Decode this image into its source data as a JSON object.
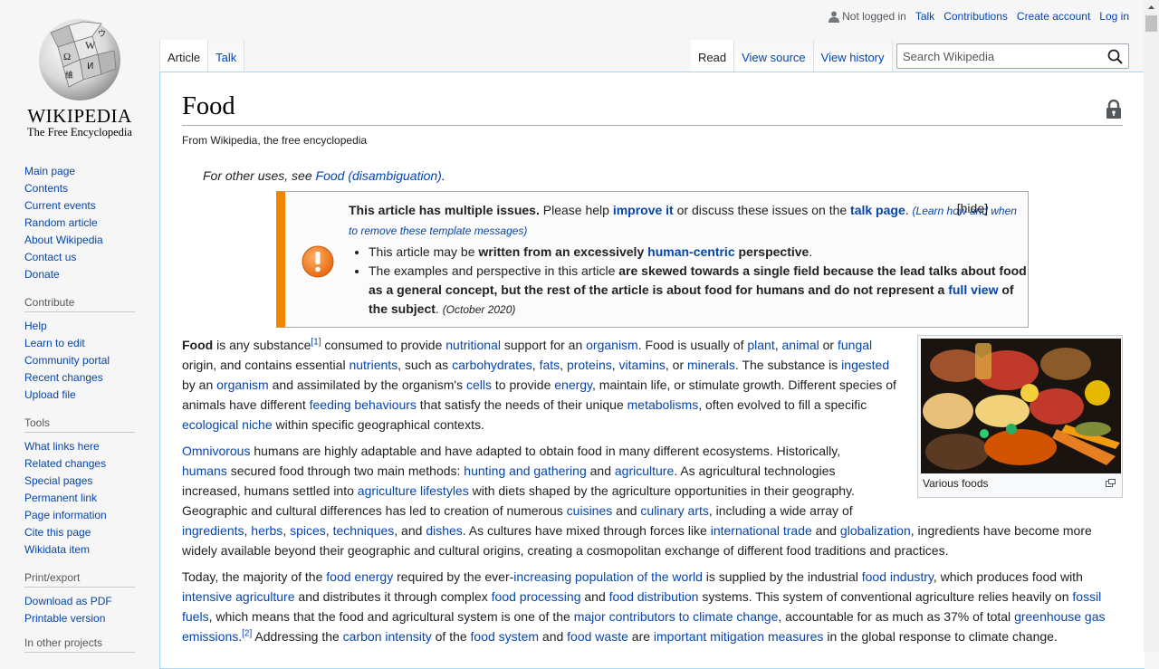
{
  "logo": {
    "wordmark": "Wikipedia",
    "wordmark_display": "WIKIPEDIA",
    "tagline": "The Free Encyclopedia"
  },
  "personal": {
    "not_logged_in": "Not logged in",
    "talk": "Talk",
    "contributions": "Contributions",
    "create_account": "Create account",
    "log_in": "Log in"
  },
  "tabs": {
    "left": [
      {
        "label": "Article"
      },
      {
        "label": "Talk"
      }
    ],
    "right": [
      {
        "label": "Read"
      },
      {
        "label": "View source"
      },
      {
        "label": "View history"
      }
    ]
  },
  "search": {
    "placeholder": "Search Wikipedia"
  },
  "sidebar": {
    "navigation": [
      "Main page",
      "Contents",
      "Current events",
      "Random article",
      "About Wikipedia",
      "Contact us",
      "Donate"
    ],
    "contribute": {
      "heading": "Contribute",
      "items": [
        "Help",
        "Learn to edit",
        "Community portal",
        "Recent changes",
        "Upload file"
      ]
    },
    "tools": {
      "heading": "Tools",
      "items": [
        "What links here",
        "Related changes",
        "Special pages",
        "Permanent link",
        "Page information",
        "Cite this page",
        "Wikidata item"
      ]
    },
    "print": {
      "heading": "Print/export",
      "items": [
        "Download as PDF",
        "Printable version"
      ]
    },
    "languages_partial": "In other projects"
  },
  "article": {
    "title": "Food",
    "site_sub": "From Wikipedia, the free encyclopedia",
    "hatnote": {
      "prefix": "For other uses, see ",
      "link": "Food (disambiguation)",
      "suffix": "."
    },
    "ambox": {
      "title": "This article has multiple issues.",
      "t1": " Please help ",
      "improve": "improve it",
      "t2": " or discuss these issues on the ",
      "talk_page": "talk page",
      "t3": ". ",
      "learn": "(Learn how and when to remove these template messages)",
      "hide": "[hide]",
      "issue1": {
        "a": "This article may be ",
        "b": "written from an excessively ",
        "link": "human-centric",
        "c": " perspective",
        "d": "."
      },
      "issue2": {
        "a": "The examples and perspective in this article ",
        "b": "are skewed towards a single field because the lead talks about food as a general concept, but the rest of the article is about food for humans and do not represent a ",
        "link": "full view",
        "c": " of the subject",
        "d": ". ",
        "date": "(October 2020)"
      }
    },
    "thumb": {
      "caption": "Various foods"
    },
    "p1": {
      "s0": "Food",
      "s1": " is any substance",
      "ref": "[1]",
      "s2": " consumed to provide ",
      "l1": "nutritional",
      "s3": " support for an ",
      "l2": "organism",
      "s4": ". Food is usually of ",
      "l3": "plant",
      "s5": ", ",
      "l4": "animal",
      "s6": " or ",
      "l5": "fungal",
      "s7": " origin, and contains essential ",
      "l6": "nutrients",
      "s8": ", such as ",
      "l7": "carbohydrates",
      "s9": ", ",
      "l8": "fats",
      "s10": ", ",
      "l9": "proteins",
      "s11": ", ",
      "l10": "vitamins",
      "s12": ", or ",
      "l11": "minerals",
      "s13": ". The substance is ",
      "l12": "ingested",
      "s14": " by an ",
      "l13": "organism",
      "s15": " and assimilated by the organism's ",
      "l14": "cells",
      "s16": " to provide ",
      "l15": "energy",
      "s17": ", maintain life, or stimulate growth. Different species of animals have different ",
      "l16": "feeding behaviours",
      "s18": " that satisfy the needs of their unique ",
      "l17": "metabolisms",
      "s19": ", often evolved to fill a specific ",
      "l18": "ecological niche",
      "s20": " within specific geographical contexts."
    },
    "p2": {
      "l1": "Omnivorous",
      "s1": " humans are highly adaptable and have adapted to obtain food in many different ecosystems. Historically, ",
      "l2": "humans",
      "s2": " secured food through two main methods: ",
      "l3": "hunting and gathering",
      "s3": " and ",
      "l4": "agriculture",
      "s4": ". As agricultural technologies increased, humans settled into ",
      "l5": "agriculture lifestyles",
      "s5": " with diets shaped by the agriculture opportunities in their geography. Geographic and cultural differences has led to creation of numerous ",
      "l6": "cuisines",
      "s6": " and ",
      "l7": "culinary arts",
      "s7": ", including a wide array of ",
      "l8": "ingredients",
      "s8": ", ",
      "l9": "herbs",
      "s9": ", ",
      "l10": "spices",
      "s10": ", ",
      "l11": "techniques",
      "s11": ", and ",
      "l12": "dishes",
      "s12": ". As cultures have mixed through forces like ",
      "l13": "international trade",
      "s13": " and ",
      "l14": "globalization",
      "s14": ", ingredients have become more widely available beyond their geographic and cultural origins, creating a cosmopolitan exchange of different food traditions and practices."
    },
    "p3": {
      "s1": "Today, the majority of the ",
      "l1": "food energy",
      "s2": " required by the ever-",
      "l2": "increasing population of the world",
      "s3": " is supplied by the industrial ",
      "l3": "food industry",
      "s4": ", which produces food with ",
      "l4": "intensive agriculture",
      "s5": " and distributes it through complex ",
      "l5": "food processing",
      "s6": " and ",
      "l6": "food distribution",
      "s7": " systems. This system of conventional agriculture relies heavily on ",
      "l7": "fossil fuels",
      "s8": ", which means that the food and agricultural system is one of the ",
      "l8": "major contributors to climate change",
      "s9": ", accountable for as much as 37% of total ",
      "l9": "greenhouse gas emissions",
      "s10": ".",
      "ref": "[2]",
      "s11": " Addressing the ",
      "l10": "carbon intensity",
      "s12": " of the ",
      "l11": "food system",
      "s13": " and ",
      "l12": "food waste",
      "s14": " are ",
      "l13": "important mitigation measures",
      "s15": " in the global response to climate change."
    }
  },
  "colors": {
    "link": "#0645ad",
    "ambox_border": "#f28500",
    "content_border": "#a7d7f9",
    "text": "#202122"
  }
}
